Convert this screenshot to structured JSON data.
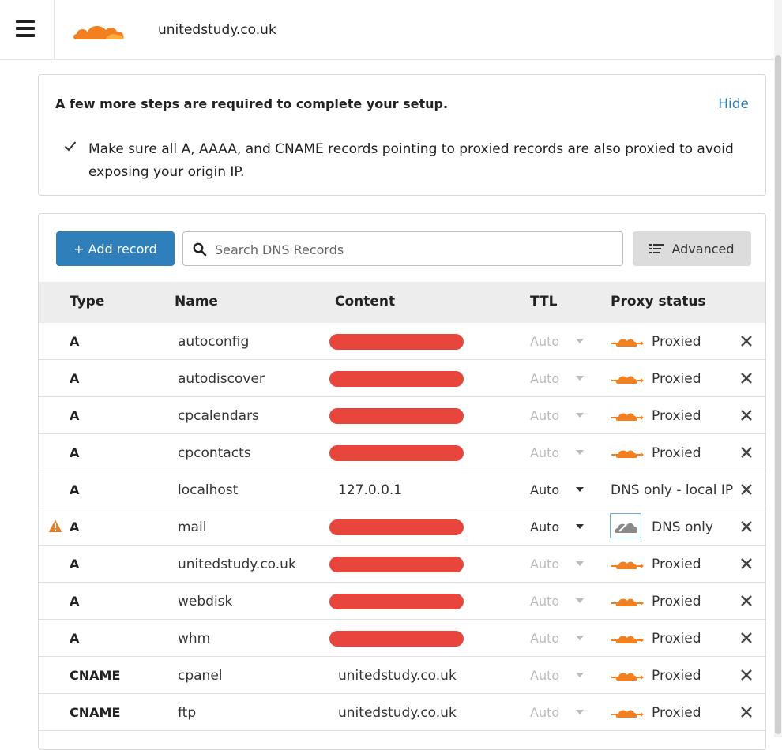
{
  "header": {
    "domain": "unitedstudy.co.uk",
    "brand_color": "#f38020"
  },
  "setup": {
    "title": "A few more steps are required to complete your setup.",
    "hide_label": "Hide",
    "steps": [
      "Make sure all A, AAAA, and CNAME records pointing to proxied records are also proxied to avoid exposing your origin IP."
    ]
  },
  "toolbar": {
    "add_label": "+ Add record",
    "search_placeholder": "Search DNS Records",
    "advanced_label": "Advanced"
  },
  "table": {
    "columns": [
      "Type",
      "Name",
      "Content",
      "TTL",
      "Proxy status"
    ],
    "rows": [
      {
        "type": "A",
        "name": "autoconfig",
        "content": "",
        "content_redacted": true,
        "ttl": "Auto",
        "ttl_editable": false,
        "proxy": "Proxied",
        "proxied": true,
        "warning": false
      },
      {
        "type": "A",
        "name": "autodiscover",
        "content": "",
        "content_redacted": true,
        "ttl": "Auto",
        "ttl_editable": false,
        "proxy": "Proxied",
        "proxied": true,
        "warning": false
      },
      {
        "type": "A",
        "name": "cpcalendars",
        "content": "",
        "content_redacted": true,
        "ttl": "Auto",
        "ttl_editable": false,
        "proxy": "Proxied",
        "proxied": true,
        "warning": false
      },
      {
        "type": "A",
        "name": "cpcontacts",
        "content": "",
        "content_redacted": true,
        "ttl": "Auto",
        "ttl_editable": false,
        "proxy": "Proxied",
        "proxied": true,
        "warning": false
      },
      {
        "type": "A",
        "name": "localhost",
        "content": "127.0.0.1",
        "content_redacted": false,
        "ttl": "Auto",
        "ttl_editable": true,
        "proxy": "DNS only - local IP",
        "proxied": false,
        "grey_cloud": false,
        "warning": false
      },
      {
        "type": "A",
        "name": "mail",
        "content": "",
        "content_redacted": true,
        "ttl": "Auto",
        "ttl_editable": true,
        "proxy": "DNS only",
        "proxied": false,
        "grey_cloud": true,
        "warning": true
      },
      {
        "type": "A",
        "name": "unitedstudy.co.uk",
        "content": "",
        "content_redacted": true,
        "ttl": "Auto",
        "ttl_editable": false,
        "proxy": "Proxied",
        "proxied": true,
        "warning": false
      },
      {
        "type": "A",
        "name": "webdisk",
        "content": "",
        "content_redacted": true,
        "ttl": "Auto",
        "ttl_editable": false,
        "proxy": "Proxied",
        "proxied": true,
        "warning": false
      },
      {
        "type": "A",
        "name": "whm",
        "content": "",
        "content_redacted": true,
        "ttl": "Auto",
        "ttl_editable": false,
        "proxy": "Proxied",
        "proxied": true,
        "warning": false
      },
      {
        "type": "CNAME",
        "name": "cpanel",
        "content": "unitedstudy.co.uk",
        "content_redacted": false,
        "ttl": "Auto",
        "ttl_editable": false,
        "proxy": "Proxied",
        "proxied": true,
        "warning": false
      },
      {
        "type": "CNAME",
        "name": "ftp",
        "content": "unitedstudy.co.uk",
        "content_redacted": false,
        "ttl": "Auto",
        "ttl_editable": false,
        "proxy": "Proxied",
        "proxied": true,
        "warning": false
      }
    ]
  },
  "colors": {
    "primary_button": "#2f7fba",
    "link": "#2c7cb0",
    "proxied_cloud": "#f38020",
    "warning": "#e57e2a",
    "redaction": "#e8463c"
  }
}
